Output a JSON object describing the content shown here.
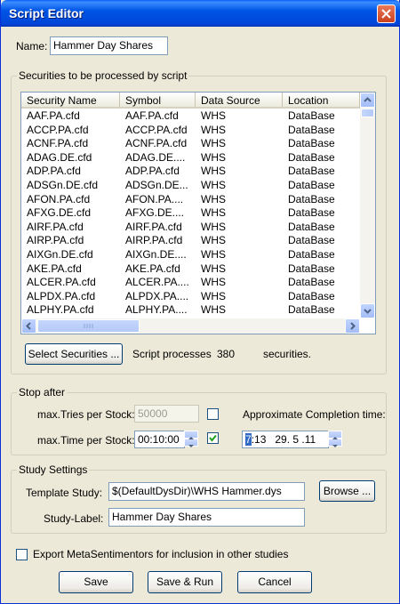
{
  "window": {
    "title": "Script Editor"
  },
  "name": {
    "label": "Name:",
    "value": "Hammer Day Shares"
  },
  "securities": {
    "group_title": "Securities to be processed by script",
    "columns": [
      "Security Name",
      "Symbol",
      "Data Source",
      "Location"
    ],
    "rows": [
      [
        "AAF.PA.cfd",
        "AAF.PA.cfd",
        "WHS",
        "DataBase"
      ],
      [
        "ACCP.PA.cfd",
        "ACCP.PA.cfd",
        "WHS",
        "DataBase"
      ],
      [
        "ACNF.PA.cfd",
        "ACNF.PA.cfd",
        "WHS",
        "DataBase"
      ],
      [
        "ADAG.DE.cfd",
        "ADAG.DE....",
        "WHS",
        "DataBase"
      ],
      [
        "ADP.PA.cfd",
        "ADP.PA.cfd",
        "WHS",
        "DataBase"
      ],
      [
        "ADSGn.DE.cfd",
        "ADSGn.DE...",
        "WHS",
        "DataBase"
      ],
      [
        "AFON.PA.cfd",
        "AFON.PA....",
        "WHS",
        "DataBase"
      ],
      [
        "AFXG.DE.cfd",
        "AFXG.DE....",
        "WHS",
        "DataBase"
      ],
      [
        "AIRF.PA.cfd",
        "AIRF.PA.cfd",
        "WHS",
        "DataBase"
      ],
      [
        "AIRP.PA.cfd",
        "AIRP.PA.cfd",
        "WHS",
        "DataBase"
      ],
      [
        "AIXGn.DE.cfd",
        "AIXGn.DE....",
        "WHS",
        "DataBase"
      ],
      [
        "AKE.PA.cfd",
        "AKE.PA.cfd",
        "WHS",
        "DataBase"
      ],
      [
        "ALCER.PA.cfd",
        "ALCER.PA....",
        "WHS",
        "DataBase"
      ],
      [
        "ALPDX.PA.cfd",
        "ALPDX.PA....",
        "WHS",
        "DataBase"
      ],
      [
        "ALPHY.PA.cfd",
        "ALPHY.PA....",
        "WHS",
        "DataBase"
      ]
    ],
    "select_button": "Select Securities ...",
    "count_prefix": "Script processes",
    "count": "380",
    "count_suffix": "securities."
  },
  "stop_after": {
    "group_title": "Stop after",
    "tries_label": "max.Tries per Stock:",
    "tries_value": "50000",
    "tries_checked": false,
    "time_label": "max.Time per Stock:",
    "time_value": "00:10:00",
    "time_checked": true,
    "completion_label": "Approximate Completion time:",
    "completion_hour": "7",
    "completion_rest": ":13   29. 5 .11"
  },
  "study": {
    "group_title": "Study Settings",
    "template_label": "Template Study:",
    "template_value": "$(DefaultDysDir)\\WHS Hammer.dys",
    "browse_button": "Browse ...",
    "label_label": "Study-Label:",
    "label_value": "Hammer Day Shares"
  },
  "export": {
    "label": "Export MetaSentimentors for inclusion in other studies",
    "checked": false
  },
  "buttons": {
    "save": "Save",
    "save_run": "Save & Run",
    "cancel": "Cancel"
  }
}
